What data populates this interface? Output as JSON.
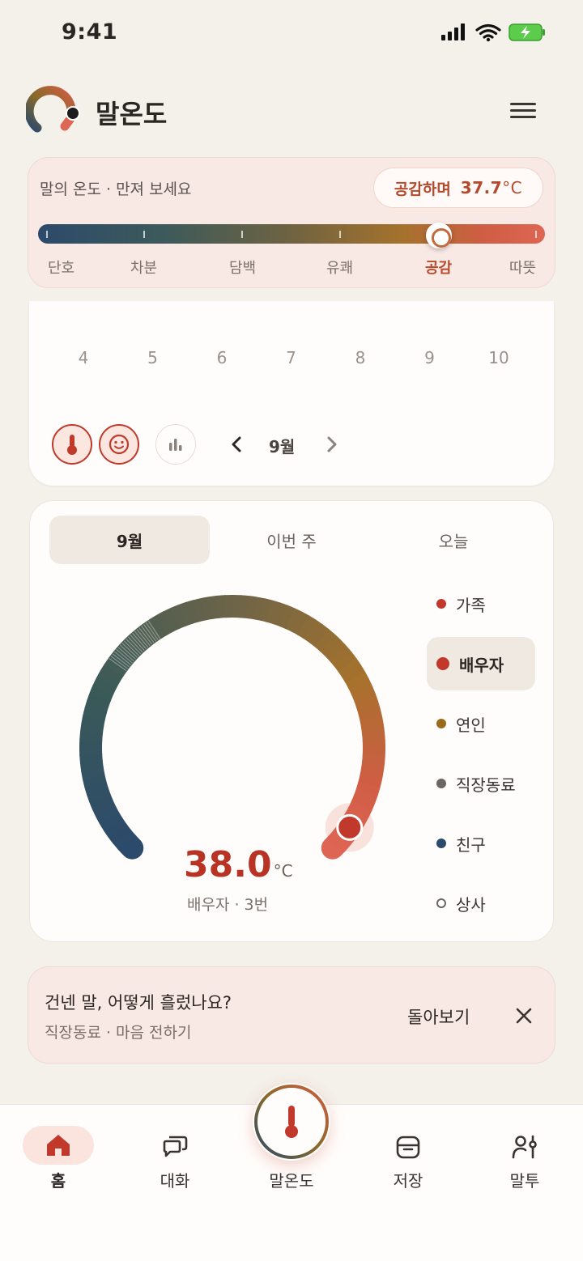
{
  "status_bar": {
    "time": "9:41"
  },
  "header": {
    "title": "말온도"
  },
  "slider": {
    "label": "말의 온도 · 만져 보세요",
    "pill_label": "공감하며",
    "pill_value": "37.7",
    "unit": "°C",
    "position": 0.79,
    "scale": [
      "단호",
      "차분",
      "담백",
      "유쾌",
      "공감",
      "따뜻"
    ],
    "active_index": 4
  },
  "calendar": {
    "days": [
      "4",
      "5",
      "6",
      "7",
      "8",
      "9",
      "10"
    ],
    "month": "9월"
  },
  "gauge_card": {
    "tabs": [
      "9월",
      "이번 주",
      "오늘"
    ],
    "active_tab": 0,
    "value": "38.0",
    "unit": "°C",
    "subtitle": "배우자 · 3번",
    "fill_fraction": 0.96,
    "relations": [
      {
        "label": "가족",
        "color": "#c0392b"
      },
      {
        "label": "배우자",
        "color": "#c0392b"
      },
      {
        "label": "연인",
        "color": "#9a6a1c"
      },
      {
        "label": "직장동료",
        "color": "#6b6660"
      },
      {
        "label": "친구",
        "color": "#2c4a6b"
      },
      {
        "label": "상사",
        "color": "#ffffff"
      }
    ],
    "active_relation": 1
  },
  "banner": {
    "title": "건넨 말, 어떻게 흘렀나요?",
    "subtitle": "직장동료 · 마음 전하기",
    "action": "돌아보기"
  },
  "nav": {
    "items": [
      "홈",
      "대화",
      "말온도",
      "저장",
      "말투"
    ],
    "active": 0
  },
  "colors": {
    "accent": "#c0392b",
    "background": "#f4f1ea",
    "card": "#fffdfb",
    "pink": "#f9e9e4"
  }
}
